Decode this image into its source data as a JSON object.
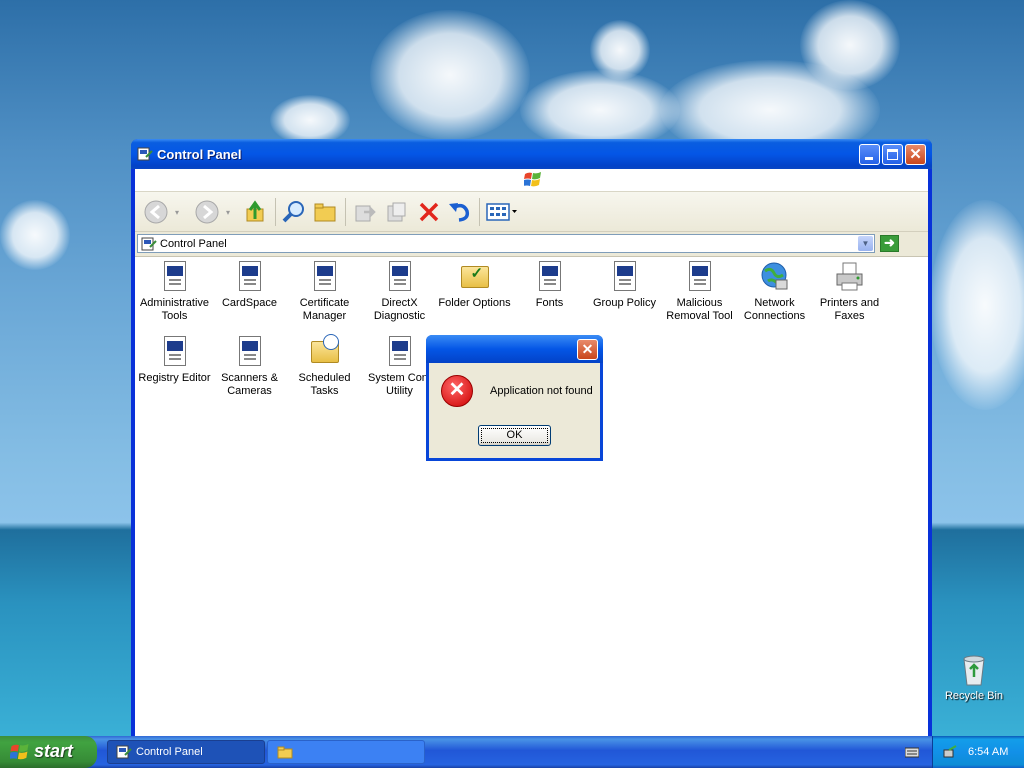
{
  "desktop": {
    "icons": [
      {
        "label": "Recycle Bin",
        "icon": "recycle-bin-icon"
      }
    ]
  },
  "window": {
    "title": "Control Panel",
    "address": "Control Panel",
    "items": [
      {
        "label": "Administrative Tools",
        "icon": "applet-icon"
      },
      {
        "label": "CardSpace",
        "icon": "applet-icon"
      },
      {
        "label": "Certificate Manager",
        "icon": "applet-icon"
      },
      {
        "label": "DirectX Diagnostic",
        "icon": "applet-icon"
      },
      {
        "label": "Folder Options",
        "icon": "folder-options-icon"
      },
      {
        "label": "Fonts",
        "icon": "applet-icon"
      },
      {
        "label": "Group Policy",
        "icon": "applet-icon"
      },
      {
        "label": "Malicious Removal Tool",
        "icon": "applet-icon"
      },
      {
        "label": "Network Connections",
        "icon": "network-globe-icon"
      },
      {
        "label": "Printers and Faxes",
        "icon": "printer-icon"
      },
      {
        "label": "Registry Editor",
        "icon": "applet-icon"
      },
      {
        "label": "Scanners & Cameras",
        "icon": "applet-icon"
      },
      {
        "label": "Scheduled Tasks",
        "icon": "scheduled-tasks-icon"
      },
      {
        "label": "System Conf Utility",
        "icon": "applet-icon"
      }
    ]
  },
  "dialog": {
    "message": "Application not found",
    "ok_label": "OK",
    "icon": "error-icon"
  },
  "taskbar": {
    "start_label": "start",
    "tasks": [
      {
        "label": "Control Panel",
        "icon": "control-panel-icon"
      },
      {
        "label": "",
        "icon": "folder-icon"
      }
    ],
    "clock": "6:54 AM"
  }
}
